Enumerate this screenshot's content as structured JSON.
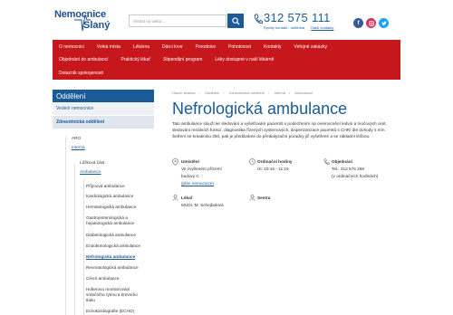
{
  "header": {
    "logo_line1": "Nemocnice",
    "logo_line2": "Slaný",
    "search_placeholder": "Hledat na webu ...",
    "phone": "312 575 111",
    "phone_links": [
      "Rychlý kontakt - ústředna",
      "Další kontakty"
    ],
    "social": [
      "f",
      "",
      ""
    ]
  },
  "nav": {
    "row1": [
      "O nemocnici",
      "Volná místa",
      "Lékárna",
      "Dárci krve",
      "Porodnice",
      "Pohotovost",
      "Kontakty",
      "Veřejné zakázky"
    ],
    "row2": [
      "Objednání do ambulancí",
      "Praktický lékař",
      "Stipendijní program",
      "Léky dostupné v naší lékárně"
    ],
    "row3": [
      "Dotazník spokojenosti"
    ]
  },
  "sidebar": {
    "heading": "Oddělení",
    "items": [
      "Vedení nemocnice",
      "Zdravotnická oddělení"
    ]
  },
  "tree": {
    "aro": "ARO",
    "interna": "Interna",
    "luzkova": "Lůžková část",
    "ambulance": "Ambulance",
    "items": [
      "Příjmová ambulance",
      "Kardiologická ambulance",
      "Hematologická ambulance",
      "Gastroenterologická a",
      "hepatologická ambulance",
      "Diabetologická ambulance",
      "Endokrinologická ambulance",
      "Nefrologická ambulance",
      "Revmatologická ambulance",
      "Cévní ambulance",
      "Holterovo monitorování",
      "srdečního rytmu a krevního",
      "tlaku",
      "Echokardiografie (ECHO)"
    ]
  },
  "breadcrumb": [
    "Hlavní stránka",
    "Oddělení",
    "Zdravotnická oddělení",
    "Interna",
    "Ambulance"
  ],
  "page": {
    "title": "Nefrologická ambulance",
    "intro": "Tato ambulance slouží ke sledování a vyšetřování pacientů s podezřením na onemocnění ledvin a močových cest, sledování renálních funkcí, diagnostika řízených systémových, dispenzarizace pacientů s CHRI dle dohody s ním. Šetření se kreatininu 250, pak je předáváme do předialyzační poradny již vyšetřené a se základní léčbou."
  },
  "info": {
    "umisteni_label": "Umístění",
    "umisteni_lines": [
      "Ve zvýšeném přízemí",
      "budovy C"
    ],
    "umisteni_link": "(plán nemocnice)",
    "hodiny_label": "Ordinační hodiny",
    "hodiny_text": "Út: 10:15 - 11:15",
    "objednani_label": "Objednání",
    "objednani_lines": [
      "Tel.: 312 575 268",
      "(v ordinačních hodinách)"
    ],
    "lekar_label": "Lékař",
    "lekar_text": "MUDr. M. Schejbalová",
    "sestra_label": "Sestra"
  },
  "colors": {
    "brand_blue": "#1a5a97",
    "nav_red": "#c6171c"
  }
}
